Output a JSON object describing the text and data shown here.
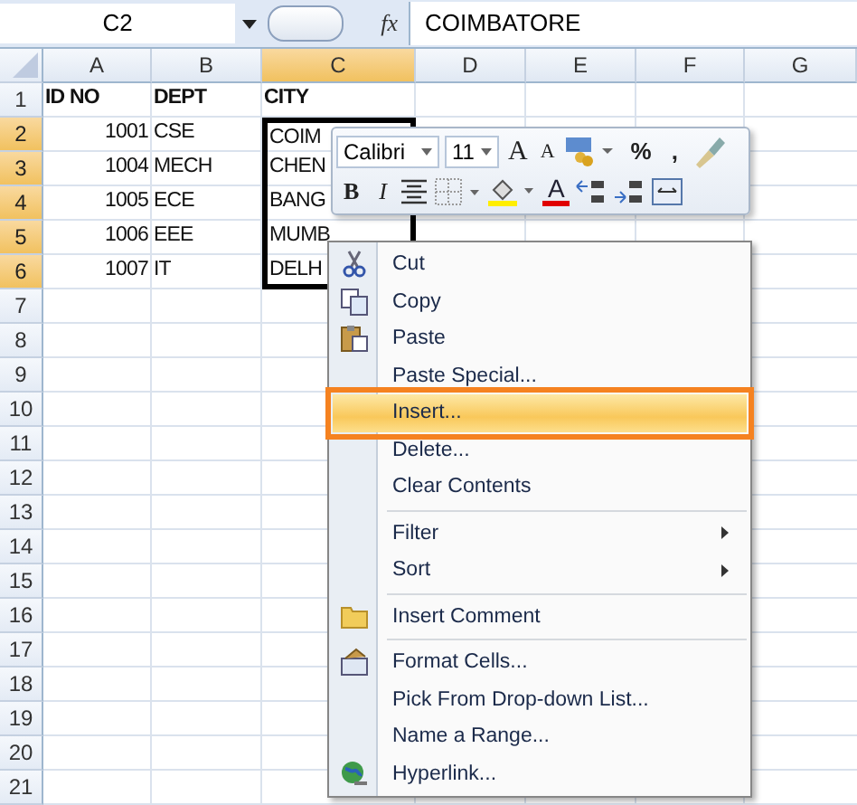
{
  "formula_bar": {
    "name_box": "C2",
    "fx": "fx",
    "value": "COIMBATORE"
  },
  "columns": [
    {
      "label": "A",
      "selected": false
    },
    {
      "label": "B",
      "selected": false
    },
    {
      "label": "C",
      "selected": true
    },
    {
      "label": "D",
      "selected": false
    },
    {
      "label": "E",
      "selected": false
    },
    {
      "label": "F",
      "selected": false
    },
    {
      "label": "G",
      "selected": false
    }
  ],
  "rows": [
    {
      "label": "1",
      "selected": false,
      "cells": [
        {
          "text": "ID NO",
          "kind": "header"
        },
        {
          "text": "DEPT",
          "kind": "header"
        },
        {
          "text": "CITY",
          "kind": "header"
        }
      ]
    },
    {
      "label": "2",
      "selected": true,
      "cells": [
        {
          "text": "1001",
          "kind": "number"
        },
        {
          "text": "CSE",
          "kind": "text"
        },
        {
          "text": "COIM",
          "kind": "text"
        }
      ]
    },
    {
      "label": "3",
      "selected": true,
      "cells": [
        {
          "text": "1004",
          "kind": "number"
        },
        {
          "text": "MECH",
          "kind": "text"
        },
        {
          "text": "CHEN",
          "kind": "text"
        }
      ]
    },
    {
      "label": "4",
      "selected": true,
      "cells": [
        {
          "text": "1005",
          "kind": "number"
        },
        {
          "text": "ECE",
          "kind": "text"
        },
        {
          "text": "BANG",
          "kind": "text"
        }
      ]
    },
    {
      "label": "5",
      "selected": true,
      "cells": [
        {
          "text": "1006",
          "kind": "number"
        },
        {
          "text": "EEE",
          "kind": "text"
        },
        {
          "text": "MUMB",
          "kind": "text"
        }
      ]
    },
    {
      "label": "6",
      "selected": true,
      "cells": [
        {
          "text": "1007",
          "kind": "number"
        },
        {
          "text": "IT",
          "kind": "text"
        },
        {
          "text": "DELH",
          "kind": "text"
        }
      ]
    },
    {
      "label": "7",
      "selected": false
    },
    {
      "label": "8",
      "selected": false
    },
    {
      "label": "9",
      "selected": false
    },
    {
      "label": "10",
      "selected": false
    },
    {
      "label": "11",
      "selected": false
    },
    {
      "label": "12",
      "selected": false
    },
    {
      "label": "13",
      "selected": false
    },
    {
      "label": "14",
      "selected": false
    },
    {
      "label": "15",
      "selected": false
    },
    {
      "label": "16",
      "selected": false
    },
    {
      "label": "17",
      "selected": false
    },
    {
      "label": "18",
      "selected": false
    },
    {
      "label": "19",
      "selected": false
    },
    {
      "label": "20",
      "selected": false
    },
    {
      "label": "21",
      "selected": false
    }
  ],
  "mini_toolbar": [
    [
      {
        "kind": "combo",
        "label": "Calibri"
      },
      {
        "kind": "combo",
        "label": "11"
      },
      {
        "kind": "grow",
        "label": "A"
      },
      {
        "kind": "shrink",
        "label": "A"
      },
      {
        "kind": "accounting"
      },
      {
        "kind": "glyph",
        "label": "%"
      },
      {
        "kind": "glyph",
        "label": ","
      },
      {
        "kind": "painter"
      }
    ],
    [
      {
        "kind": "bold",
        "label": "B"
      },
      {
        "kind": "italic",
        "label": "I"
      },
      {
        "kind": "center"
      },
      {
        "kind": "borders"
      },
      {
        "kind": "fill"
      },
      {
        "kind": "fontcolor",
        "label": "A"
      },
      {
        "kind": "incdec"
      },
      {
        "kind": "decdec"
      },
      {
        "kind": "merge"
      }
    ]
  ],
  "context_menu": [
    {
      "label": "Cut",
      "selected": false,
      "submenu": false,
      "separator_after": false
    },
    {
      "label": "Copy",
      "selected": false,
      "submenu": false,
      "separator_after": false
    },
    {
      "label": "Paste",
      "selected": false,
      "submenu": false,
      "separator_after": false
    },
    {
      "label": "Paste Special...",
      "selected": false,
      "submenu": false,
      "separator_after": false
    },
    {
      "label": "Insert...",
      "selected": true,
      "submenu": false,
      "separator_after": false
    },
    {
      "label": "Delete...",
      "selected": false,
      "submenu": false,
      "separator_after": false
    },
    {
      "label": "Clear Contents",
      "selected": false,
      "submenu": false,
      "separator_after": true
    },
    {
      "label": "Filter",
      "selected": false,
      "submenu": true,
      "separator_after": false
    },
    {
      "label": "Sort",
      "selected": false,
      "submenu": true,
      "separator_after": true
    },
    {
      "label": "Insert Comment",
      "selected": false,
      "submenu": false,
      "separator_after": true
    },
    {
      "label": "Format Cells...",
      "selected": false,
      "submenu": false,
      "separator_after": false
    },
    {
      "label": "Pick From Drop-down List...",
      "selected": false,
      "submenu": false,
      "separator_after": false
    },
    {
      "label": "Name a Range...",
      "selected": false,
      "submenu": false,
      "separator_after": false
    },
    {
      "label": "Hyperlink...",
      "selected": false,
      "submenu": false,
      "separator_after": false
    }
  ]
}
